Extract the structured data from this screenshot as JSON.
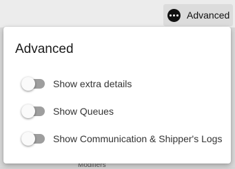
{
  "background": {
    "hint_text": "Modifiers"
  },
  "toolbar": {
    "advanced_icon": "more-horizontal-icon",
    "advanced_label": "Advanced"
  },
  "panel": {
    "title": "Advanced",
    "options": [
      {
        "label": "Show extra details",
        "checked": false
      },
      {
        "label": "Show Queues",
        "checked": false
      },
      {
        "label": "Show Communication & Shipper's Logs",
        "checked": false
      }
    ]
  },
  "colors": {
    "toggle_track_off": "#9e9e9e",
    "toggle_thumb": "#fafafa",
    "panel_background": "#ffffff"
  }
}
